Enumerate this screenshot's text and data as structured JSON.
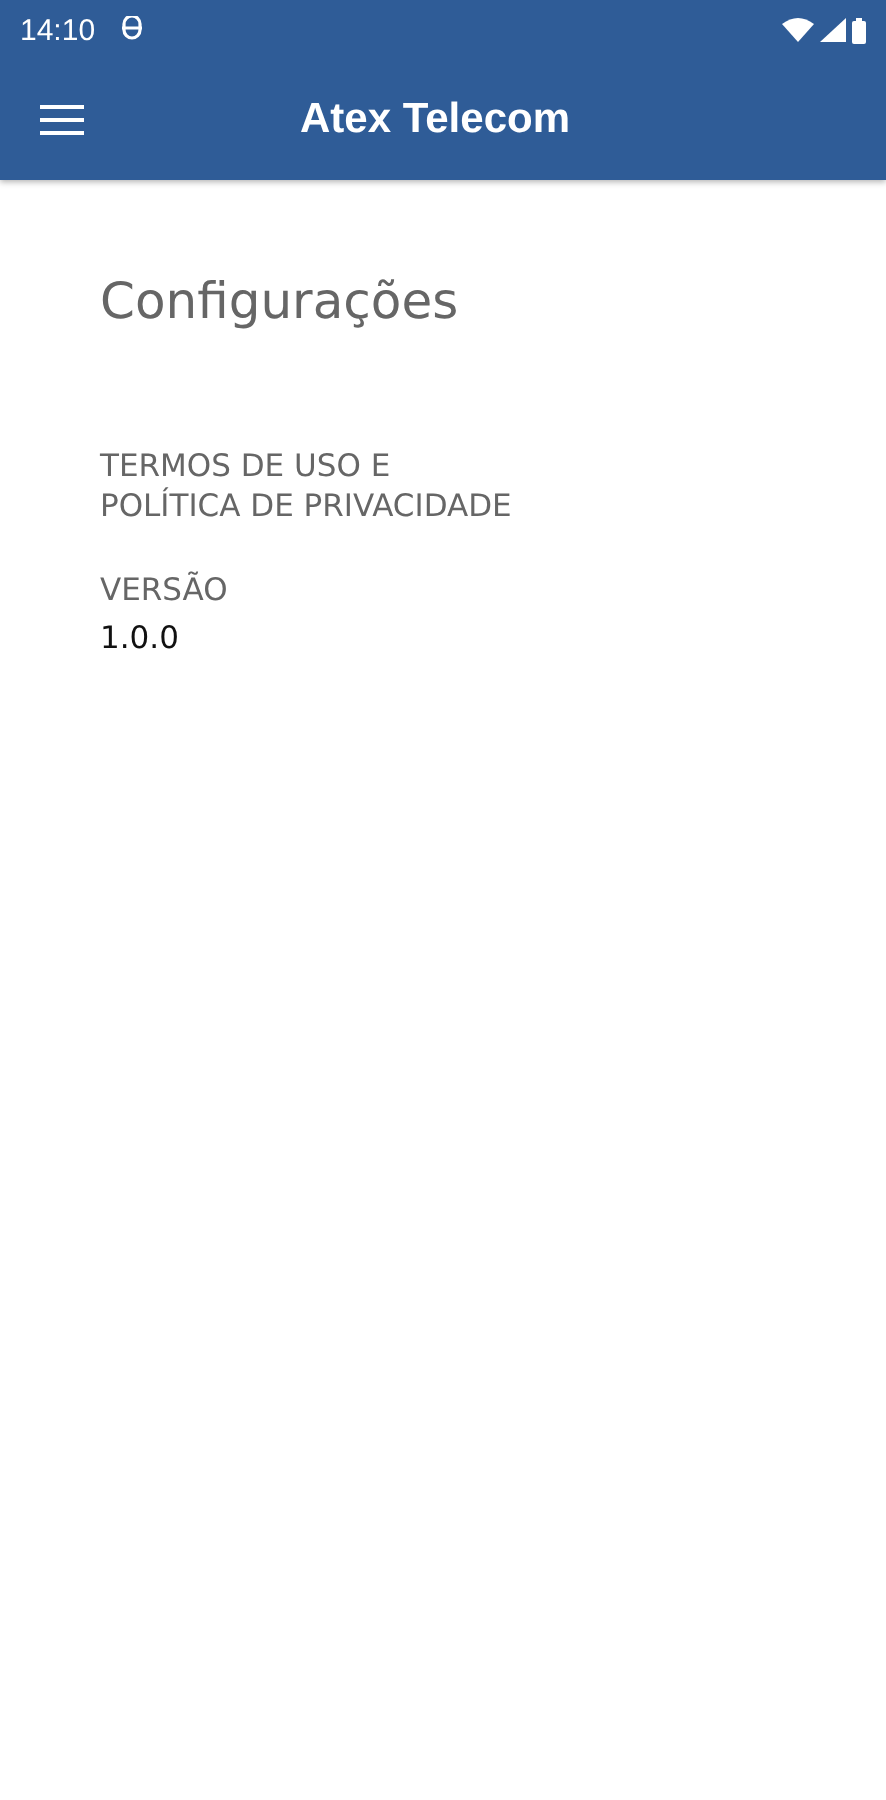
{
  "status_bar": {
    "time": "14:10"
  },
  "app_bar": {
    "title": "Atex Telecom"
  },
  "page": {
    "title": "Configurações",
    "items": [
      {
        "kind": "link",
        "label": "TERMOS DE USO E\nPOLÍTICA DE PRIVACIDADE"
      },
      {
        "kind": "info",
        "label": "VERSÃO",
        "value": "1.0.0"
      }
    ]
  }
}
